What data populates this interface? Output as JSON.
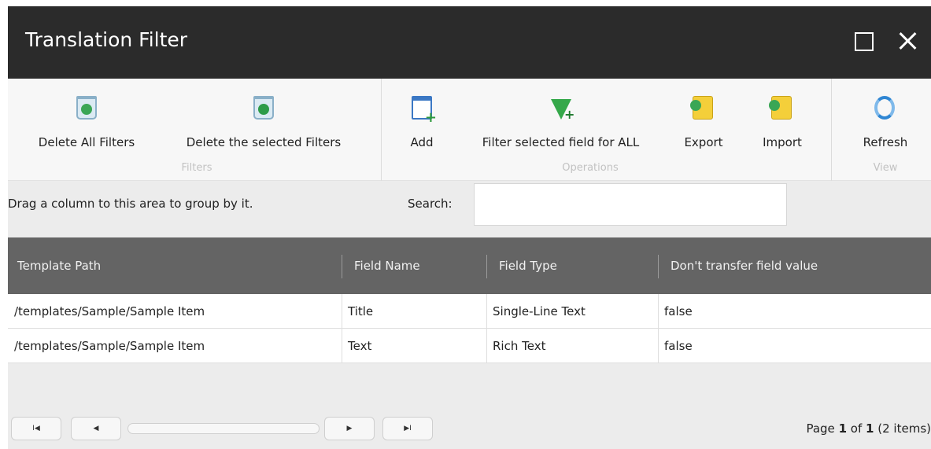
{
  "window": {
    "title": "Translation Filter"
  },
  "ribbon": {
    "groups": {
      "filters": "Filters",
      "operations": "Operations",
      "view": "View"
    },
    "buttons": {
      "delete_all": "Delete All Filters",
      "delete_selected": "Delete the selected Filters",
      "add": "Add",
      "filter_all": "Filter selected field for ALL",
      "export": "Export",
      "import": "Import",
      "refresh": "Refresh"
    },
    "icons": {
      "delete_all": "recycle-bin-icon",
      "delete_selected": "recycle-bin-check-icon",
      "add": "add-window-icon",
      "filter_all": "filter-add-icon",
      "export": "folder-export-icon",
      "import": "folder-import-icon",
      "refresh": "refresh-icon"
    }
  },
  "grid": {
    "group_hint": "Drag a column to this area to group by it.",
    "search_label": "Search:",
    "search_value": "",
    "columns": [
      "Template Path",
      "Field Name",
      "Field Type",
      "Don't transfer field value"
    ],
    "rows": [
      [
        "/templates/Sample/Sample Item",
        "Title",
        "Single-Line Text",
        "false"
      ],
      [
        "/templates/Sample/Sample Item",
        "Text",
        "Rich Text",
        "false"
      ]
    ]
  },
  "pager": {
    "first": "I◀",
    "prev": "◀",
    "next": "▶",
    "last": "▶I",
    "page_prefix": "Page",
    "page_current": "1",
    "page_of": "of",
    "page_total": "1",
    "items_text": "(2 items)"
  },
  "colors": {
    "titlebar": "#2b2b2b",
    "header": "#646464",
    "ribbon": "#f7f7f7",
    "background": "#ececec"
  }
}
